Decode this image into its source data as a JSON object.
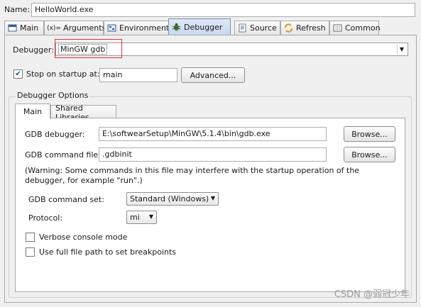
{
  "name": {
    "label": "Name:",
    "value": "HelloWorld.exe"
  },
  "tabs": [
    {
      "label": "Main",
      "icon": "main-tab-icon"
    },
    {
      "label": "Arguments",
      "icon": "arguments-icon"
    },
    {
      "label": "Environment",
      "icon": "environment-icon"
    },
    {
      "label": "Debugger",
      "icon": "debugger-bug-icon"
    },
    {
      "label": "Source",
      "icon": "source-icon"
    },
    {
      "label": "Refresh",
      "icon": "refresh-icon"
    },
    {
      "label": "Common",
      "icon": "common-icon"
    }
  ],
  "tab_icon_glyphs": {
    "arguments": "(x)="
  },
  "debugger": {
    "label": "Debugger:",
    "selected": "MinGW gdb"
  },
  "stop": {
    "label": "Stop on startup at:",
    "value": "main",
    "checked": true
  },
  "advanced_label": "Advanced...",
  "group_label": "Debugger Options",
  "inner_tabs": [
    "Main",
    "Shared Libraries"
  ],
  "gdb_debugger": {
    "label": "GDB debugger:",
    "value": "E:\\softwearSetup\\MinGW\\5.1.4\\bin\\gdb.exe",
    "browse": "Browse..."
  },
  "gdb_command_file": {
    "label": "GDB command file:",
    "value": ".gdbinit",
    "browse": "Browse..."
  },
  "warning": "(Warning: Some commands in this file may interfere with the startup operation of the debugger, for example \"run\".)",
  "gdb_command_set": {
    "label": "GDB command set:",
    "selected": "Standard (Windows)"
  },
  "protocol": {
    "label": "Protocol:",
    "selected": "mi"
  },
  "verbose": {
    "label": "Verbose console mode",
    "checked": false
  },
  "full_path": {
    "label": "Use full file path to set breakpoints",
    "checked": false
  },
  "watermark": "CSDN @弱冠少年",
  "colors": {
    "highlight": "#d9363e",
    "active_tab": "#c8d9ef"
  }
}
